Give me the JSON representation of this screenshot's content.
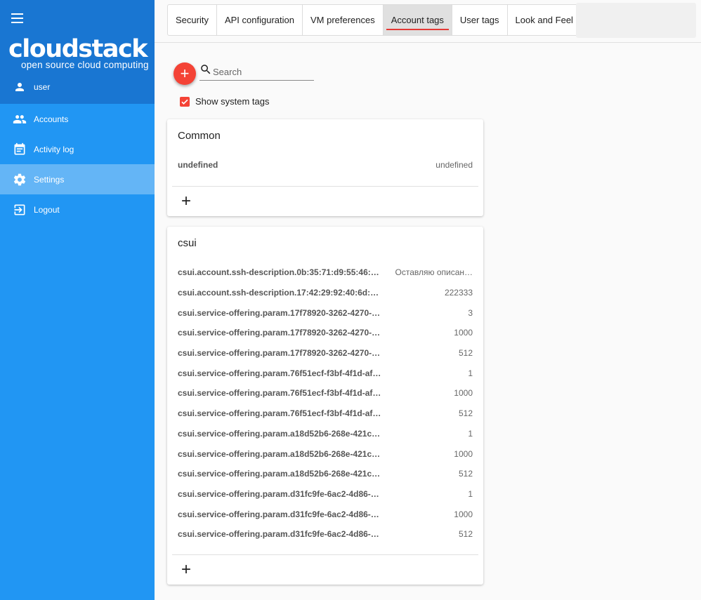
{
  "sidebar": {
    "logo_main": "cloudstack",
    "logo_sub": "open source cloud computing",
    "user": "user",
    "items": [
      {
        "label": "Accounts",
        "icon": "people-icon"
      },
      {
        "label": "Activity log",
        "icon": "calendar-icon"
      },
      {
        "label": "Settings",
        "icon": "gear-icon",
        "active": true
      },
      {
        "label": "Logout",
        "icon": "logout-icon"
      }
    ]
  },
  "tabs": [
    {
      "label": "Security"
    },
    {
      "label": "API configuration"
    },
    {
      "label": "VM preferences"
    },
    {
      "label": "Account tags",
      "active": true
    },
    {
      "label": "User tags"
    },
    {
      "label": "Look and Feel"
    }
  ],
  "toolbar": {
    "add_label": "+",
    "search_placeholder": "Search",
    "show_system_tags": "Show system tags",
    "show_system_tags_checked": true
  },
  "cards": {
    "common": {
      "title": "Common",
      "rows": [
        {
          "key": "undefined",
          "value": "undefined"
        }
      ],
      "add_label": "+"
    },
    "csui": {
      "title": "csui",
      "rows": [
        {
          "key": "csui.account.ssh-description.0b:35:71:d9:55:46:…",
          "value": "Оставляю описан…"
        },
        {
          "key": "csui.account.ssh-description.17:42:29:92:40:6d:…",
          "value": "222333"
        },
        {
          "key": "csui.service-offering.param.17f78920-3262-4270-…",
          "value": "3"
        },
        {
          "key": "csui.service-offering.param.17f78920-3262-4270-…",
          "value": "1000"
        },
        {
          "key": "csui.service-offering.param.17f78920-3262-4270-…",
          "value": "512"
        },
        {
          "key": "csui.service-offering.param.76f51ecf-f3bf-4f1d-af…",
          "value": "1"
        },
        {
          "key": "csui.service-offering.param.76f51ecf-f3bf-4f1d-af…",
          "value": "1000"
        },
        {
          "key": "csui.service-offering.param.76f51ecf-f3bf-4f1d-af…",
          "value": "512"
        },
        {
          "key": "csui.service-offering.param.a18d52b6-268e-421c…",
          "value": "1"
        },
        {
          "key": "csui.service-offering.param.a18d52b6-268e-421c…",
          "value": "1000"
        },
        {
          "key": "csui.service-offering.param.a18d52b6-268e-421c…",
          "value": "512"
        },
        {
          "key": "csui.service-offering.param.d31fc9fe-6ac2-4d86-…",
          "value": "1"
        },
        {
          "key": "csui.service-offering.param.d31fc9fe-6ac2-4d86-…",
          "value": "1000"
        },
        {
          "key": "csui.service-offering.param.d31fc9fe-6ac2-4d86-…",
          "value": "512"
        }
      ],
      "add_label": "+"
    }
  },
  "colors": {
    "sidebar": "#2196f3",
    "sidebar_head": "#1976d2",
    "sidebar_active": "#64b5f6",
    "accent": "#f44336",
    "tab_underline": "#e53935"
  }
}
